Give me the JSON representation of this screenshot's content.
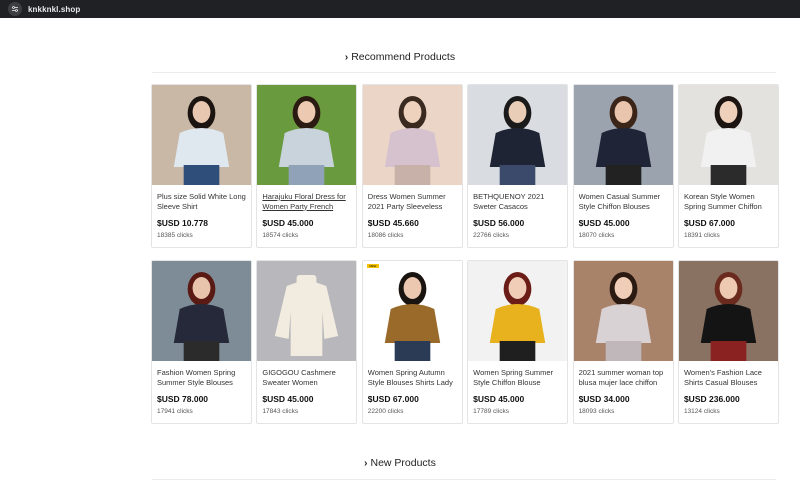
{
  "browser": {
    "url": "knkknkl.shop"
  },
  "sections": {
    "recommend": {
      "title": "Recommend Products"
    },
    "new": {
      "title": "New Products"
    }
  },
  "products": [
    {
      "name": "Plus size Solid White Long Sleeve Shirt",
      "price": "$USD 10.778",
      "clicks": "18385 clicks",
      "underlined": false,
      "icon": "blouse-photo",
      "colors": {
        "bg": "#c9b8a6",
        "top": "#dfe7ef",
        "hair": "#1c1410",
        "skin": "#e8c7b0",
        "bottom": "#2f4f7a"
      }
    },
    {
      "name": "Harajuku Floral Dress for Women Party French",
      "price": "$USD 45.000",
      "clicks": "18574 clicks",
      "underlined": true,
      "icon": "dress-photo",
      "colors": {
        "bg": "#6a9a3e",
        "top": "#c9d3dc",
        "hair": "#2a1a12",
        "skin": "#ecc9b0",
        "bottom": "#8fa2b8"
      }
    },
    {
      "name": "Dress Women Summer 2021 Party Sleeveless",
      "price": "$USD 45.660",
      "clicks": "18086 clicks",
      "underlined": false,
      "icon": "dress-photo",
      "colors": {
        "bg": "#ead5c6",
        "top": "#d6c2cf",
        "hair": "#3a2a20",
        "skin": "#efd2bd",
        "bottom": "#c8b1a8"
      }
    },
    {
      "name": "BETHQUENOY 2021 Sweter Casacos",
      "price": "$USD 56.000",
      "clicks": "22766 clicks",
      "underlined": false,
      "icon": "cardigan-photo",
      "colors": {
        "bg": "#d9dde2",
        "top": "#1e2433",
        "hair": "#1a1a1a",
        "skin": "#e9cdb7",
        "bottom": "#3b4a6b"
      }
    },
    {
      "name": "Women Casual Summer Style Chiffon Blouses",
      "price": "$USD 45.000",
      "clicks": "18070 clicks",
      "underlined": false,
      "icon": "blouse-photo",
      "colors": {
        "bg": "#9aa3ae",
        "top": "#1f2436",
        "hair": "#3b2518",
        "skin": "#eac5ad",
        "bottom": "#222"
      }
    },
    {
      "name": "Korean Style Women Spring Summer Chiffon",
      "price": "$USD 67.000",
      "clicks": "18391 clicks",
      "underlined": false,
      "icon": "blouse-photo",
      "colors": {
        "bg": "#e4e2df",
        "top": "#f1f1f1",
        "hair": "#1b1410",
        "skin": "#efd0bb",
        "bottom": "#2b2b2b"
      }
    },
    {
      "name": "Fashion Women Spring Summer Style Blouses",
      "price": "$USD 78.000",
      "clicks": "17941 clicks",
      "underlined": false,
      "icon": "blouse-photo",
      "colors": {
        "bg": "#7d8c97",
        "top": "#25293a",
        "hair": "#5a1a14",
        "skin": "#e9c4ac",
        "bottom": "#2b2b2b"
      }
    },
    {
      "name": "GIGOGOU Cashmere Sweater Women",
      "price": "$USD 45.000",
      "clicks": "17843 clicks",
      "underlined": false,
      "icon": "sweater-photo",
      "colors": {
        "bg": "#b8b7bc",
        "top": "#f1ecdf",
        "hair": "#b8b7bc",
        "skin": "#b8b7bc",
        "bottom": "#e9e2d2"
      }
    },
    {
      "name": "Women Spring Autumn Style Blouses Shirts Lady",
      "price": "$USD 67.000",
      "clicks": "22200 clicks",
      "underlined": false,
      "icon": "blouse-photo",
      "colors": {
        "bg": "#ffffff",
        "top": "#9a6a2a",
        "hair": "#1a1410",
        "skin": "#ecc8b0",
        "bottom": "#2b3a55"
      }
    },
    {
      "name": "Women Spring Summer Style Chiffon Blouse",
      "price": "$USD 45.000",
      "clicks": "17789 clicks",
      "underlined": false,
      "icon": "blouse-photo",
      "colors": {
        "bg": "#f2f2f2",
        "top": "#e8b21f",
        "hair": "#6b1c16",
        "skin": "#efcdb7",
        "bottom": "#1f1f1f"
      }
    },
    {
      "name": "2021 summer woman top blusa mujer lace chiffon",
      "price": "$USD 34.000",
      "clicks": "18093 clicks",
      "underlined": false,
      "icon": "blouse-photo",
      "colors": {
        "bg": "#a9826a",
        "top": "#d8d2d4",
        "hair": "#2a1a12",
        "skin": "#efcdb7",
        "bottom": "#c0b7bb"
      }
    },
    {
      "name": "Women's Fashion Lace Shirts Casual Blouses",
      "price": "$USD 236.000",
      "clicks": "13124 clicks",
      "underlined": false,
      "icon": "blouse-photo",
      "colors": {
        "bg": "#8a7262",
        "top": "#141414",
        "hair": "#6a2a1e",
        "skin": "#eec9b2",
        "bottom": "#8a2222"
      }
    }
  ],
  "badge": "NEW"
}
